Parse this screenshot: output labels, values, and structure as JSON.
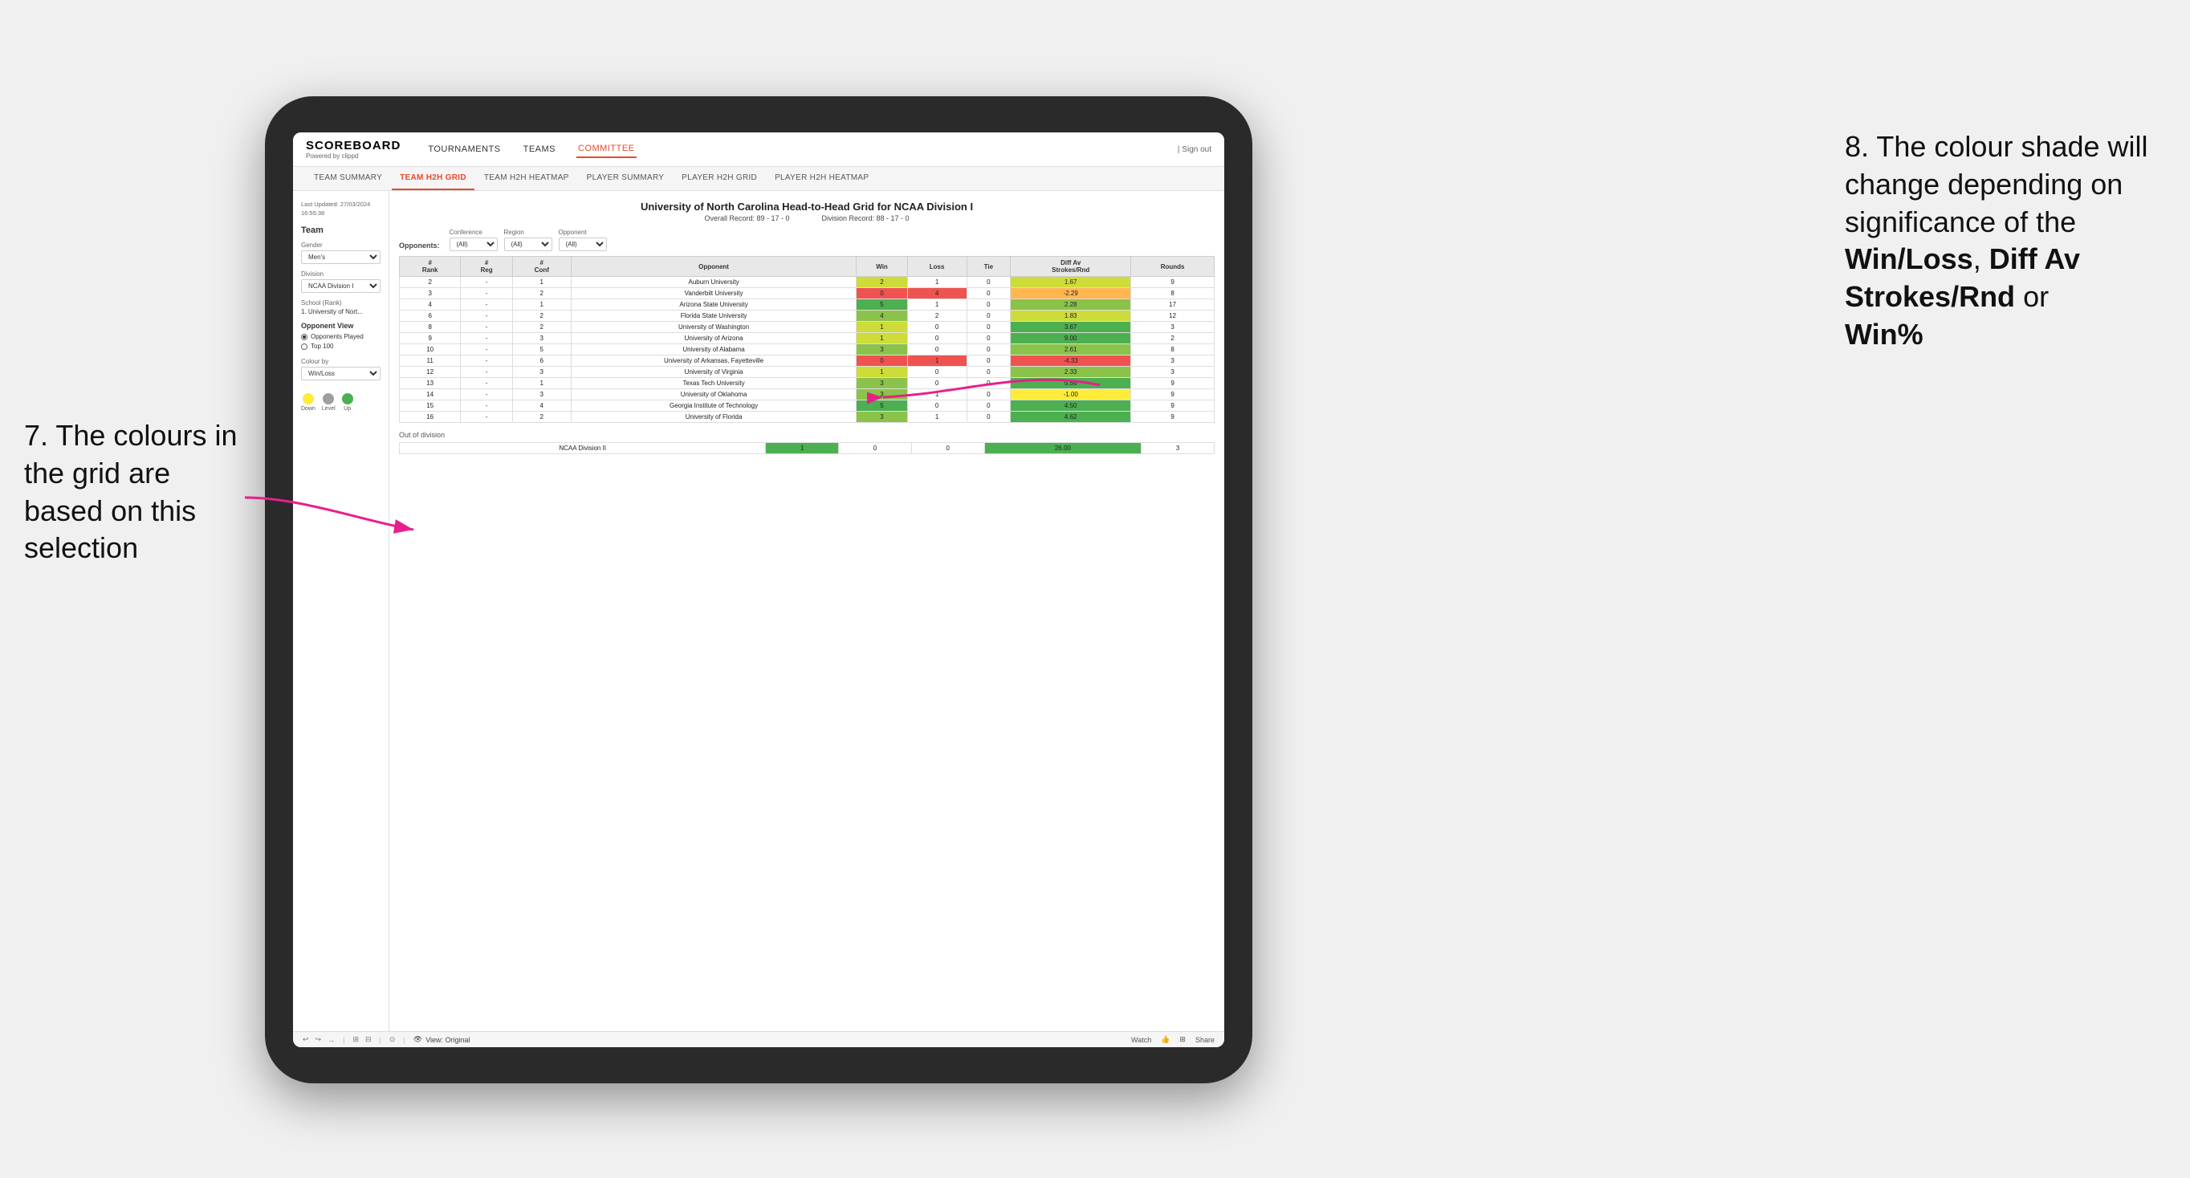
{
  "annotations": {
    "left_title": "7. The colours in the grid are based on this selection",
    "right_title": "8. The colour shade will change depending on significance of the",
    "right_bold1": "Win/Loss",
    "right_sep1": ", ",
    "right_bold2": "Diff Av Strokes/Rnd",
    "right_sep2": " or",
    "right_bold3": "Win%"
  },
  "nav": {
    "logo": "SCOREBOARD",
    "logo_sub": "Powered by clippd",
    "links": [
      "TOURNAMENTS",
      "TEAMS",
      "COMMITTEE"
    ],
    "active": "COMMITTEE",
    "sign_out": "Sign out"
  },
  "sub_nav": {
    "links": [
      "TEAM SUMMARY",
      "TEAM H2H GRID",
      "TEAM H2H HEATMAP",
      "PLAYER SUMMARY",
      "PLAYER H2H GRID",
      "PLAYER H2H HEATMAP"
    ],
    "active": "TEAM H2H GRID"
  },
  "left_panel": {
    "meta": "Last Updated: 27/03/2024\n16:55:38",
    "team_label": "Team",
    "gender_label": "Gender",
    "gender_value": "Men's",
    "division_label": "Division",
    "division_value": "NCAA Division I",
    "school_label": "School (Rank)",
    "school_value": "1. University of Nort...",
    "opponent_view_title": "Opponent View",
    "radio1": "Opponents Played",
    "radio2": "Top 100",
    "colour_by_label": "Colour by",
    "colour_by_value": "Win/Loss",
    "legend": [
      {
        "label": "Down",
        "color": "#FFEB3B"
      },
      {
        "label": "Level",
        "color": "#9E9E9E"
      },
      {
        "label": "Up",
        "color": "#4CAF50"
      }
    ]
  },
  "grid": {
    "title": "University of North Carolina Head-to-Head Grid for NCAA Division I",
    "overall_record": "Overall Record: 89 - 17 - 0",
    "division_record": "Division Record: 88 - 17 - 0",
    "filters": {
      "conference_label": "Conference",
      "conference_value": "(All)",
      "region_label": "Region",
      "region_value": "(All)",
      "opponent_label": "Opponent",
      "opponent_value": "(All)",
      "opponents_label": "Opponents:"
    },
    "table_headers": [
      "#\nRank",
      "#\nReg",
      "#\nConf",
      "Opponent",
      "Win",
      "Loss",
      "Tie",
      "Diff Av\nStrokes/Rnd",
      "Rounds"
    ],
    "rows": [
      {
        "rank": "2",
        "reg": "-",
        "conf": "1",
        "opponent": "Auburn University",
        "win": "2",
        "loss": "1",
        "tie": "0",
        "diff": "1.67",
        "rounds": "9",
        "win_color": "cell-yellow",
        "diff_color": "cell-green-light"
      },
      {
        "rank": "3",
        "reg": "-",
        "conf": "2",
        "opponent": "Vanderbilt University",
        "win": "0",
        "loss": "4",
        "tie": "0",
        "diff": "-2.29",
        "rounds": "8",
        "win_color": "cell-red",
        "diff_color": "cell-orange"
      },
      {
        "rank": "4",
        "reg": "-",
        "conf": "1",
        "opponent": "Arizona State University",
        "win": "5",
        "loss": "1",
        "tie": "0",
        "diff": "2.28",
        "rounds": "17",
        "win_color": "cell-green-dark",
        "diff_color": "cell-green-med"
      },
      {
        "rank": "6",
        "reg": "-",
        "conf": "2",
        "opponent": "Florida State University",
        "win": "4",
        "loss": "2",
        "tie": "0",
        "diff": "1.83",
        "rounds": "12",
        "win_color": "cell-green-light",
        "diff_color": "cell-green-light"
      },
      {
        "rank": "8",
        "reg": "-",
        "conf": "2",
        "opponent": "University of Washington",
        "win": "1",
        "loss": "0",
        "tie": "0",
        "diff": "3.67",
        "rounds": "3",
        "win_color": "cell-green-dark",
        "diff_color": "cell-green-dark"
      },
      {
        "rank": "9",
        "reg": "-",
        "conf": "3",
        "opponent": "University of Arizona",
        "win": "1",
        "loss": "0",
        "tie": "0",
        "diff": "9.00",
        "rounds": "2",
        "win_color": "cell-green-dark",
        "diff_color": "cell-green-dark"
      },
      {
        "rank": "10",
        "reg": "-",
        "conf": "5",
        "opponent": "University of Alabama",
        "win": "3",
        "loss": "0",
        "tie": "0",
        "diff": "2.61",
        "rounds": "8",
        "win_color": "cell-green-dark",
        "diff_color": "cell-green-med"
      },
      {
        "rank": "11",
        "reg": "-",
        "conf": "6",
        "opponent": "University of Arkansas, Fayetteville",
        "win": "0",
        "loss": "1",
        "tie": "0",
        "diff": "-4.33",
        "rounds": "3",
        "win_color": "cell-red",
        "diff_color": "cell-red"
      },
      {
        "rank": "12",
        "reg": "-",
        "conf": "3",
        "opponent": "University of Virginia",
        "win": "1",
        "loss": "0",
        "tie": "0",
        "diff": "2.33",
        "rounds": "3",
        "win_color": "cell-green-dark",
        "diff_color": "cell-green-med"
      },
      {
        "rank": "13",
        "reg": "-",
        "conf": "1",
        "opponent": "Texas Tech University",
        "win": "3",
        "loss": "0",
        "tie": "0",
        "diff": "5.56",
        "rounds": "9",
        "win_color": "cell-green-dark",
        "diff_color": "cell-green-dark"
      },
      {
        "rank": "14",
        "reg": "-",
        "conf": "3",
        "opponent": "University of Oklahoma",
        "win": "3",
        "loss": "1",
        "tie": "0",
        "diff": "-1.00",
        "rounds": "9",
        "win_color": "cell-green-light",
        "diff_color": "cell-yellow"
      },
      {
        "rank": "15",
        "reg": "-",
        "conf": "4",
        "opponent": "Georgia Institute of Technology",
        "win": "5",
        "loss": "0",
        "tie": "0",
        "diff": "4.50",
        "rounds": "9",
        "win_color": "cell-green-dark",
        "diff_color": "cell-green-dark"
      },
      {
        "rank": "16",
        "reg": "-",
        "conf": "2",
        "opponent": "University of Florida",
        "win": "3",
        "loss": "1",
        "tie": "0",
        "diff": "4.62",
        "rounds": "9",
        "win_color": "cell-green-light",
        "diff_color": "cell-green-dark"
      }
    ],
    "out_of_division_label": "Out of division",
    "out_of_division_row": {
      "division": "NCAA Division II",
      "win": "1",
      "loss": "0",
      "tie": "0",
      "diff": "26.00",
      "rounds": "3",
      "win_color": "cell-green-dark",
      "diff_color": "cell-green-dark"
    }
  },
  "toolbar": {
    "view_label": "View: Original",
    "watch_label": "Watch",
    "share_label": "Share"
  }
}
